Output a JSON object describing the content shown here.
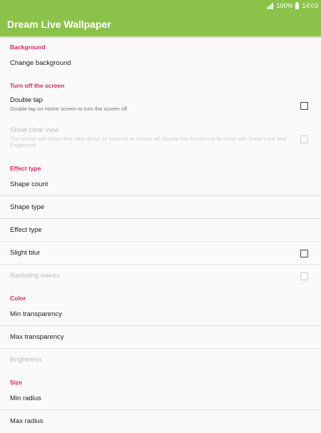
{
  "status_bar": {
    "battery": "100%",
    "time": "14:03"
  },
  "app_bar": {
    "title": "Dream Live Wallpaper"
  },
  "sections": {
    "background": {
      "header": "Background",
      "change_background": "Change background"
    },
    "turn_off": {
      "header": "Turn off the screen",
      "double_tap": {
        "title": "Double tap",
        "summary": "Double tap on Home screen to turn the screen off.",
        "checked": false
      },
      "show_clear_view": {
        "title": "Show clear view",
        "summary": "The screen will show clear view about 10 seconds to screen off. Enable this function to fix issue with Smart Lock and Fingerprint",
        "checked": false,
        "enabled": false
      }
    },
    "effect_type": {
      "header": "Effect type",
      "shape_count": "Shape count",
      "shape_type": "Shape type",
      "effect_type": "Effect type",
      "slight_blur": {
        "title": "Slight blur",
        "checked": false
      },
      "radiating_waves": {
        "title": "Radiating waves",
        "checked": false,
        "enabled": false
      }
    },
    "color": {
      "header": "Color",
      "min_transparency": "Min transparency",
      "max_transparency": "Max transparency",
      "brightness": {
        "title": "Brightness",
        "enabled": false
      }
    },
    "size": {
      "header": "Size",
      "min_radius": "Min radius",
      "max_radius": "Max radius"
    }
  },
  "colors": {
    "accent": "#e91e63",
    "app_bar": "#8bc34a",
    "background": "#fafafa"
  }
}
